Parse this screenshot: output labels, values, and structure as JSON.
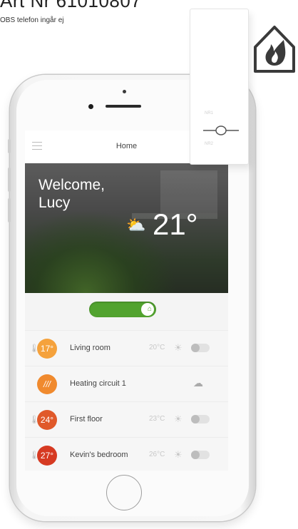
{
  "header": {
    "title": "Art Nr 61010807",
    "note": "OBS telefon ingår ej"
  },
  "app": {
    "nav_title": "Home",
    "welcome_line1": "Welcome,",
    "welcome_line2": "Lucy",
    "outside_temp": "21°",
    "weather_icon": "partly-cloudy-icon",
    "mode_toggle": {
      "state": "on",
      "icon": "house-icon",
      "color": "#52a32f"
    }
  },
  "rows": [
    {
      "badge": "17°",
      "label": "Living room",
      "setpoint": "20°C",
      "badge_color": "#f5a23c"
    },
    {
      "badge": "///",
      "label": "Heating circuit 1",
      "setpoint": "",
      "badge_color": "#f08a2e"
    },
    {
      "badge": "24°",
      "label": "First floor",
      "setpoint": "23°C",
      "badge_color": "#e0592a"
    },
    {
      "badge": "27°",
      "label": "Kevin's bedroom",
      "setpoint": "26°C",
      "badge_color": "#d63a22"
    }
  ],
  "device": {
    "symbol": "⊸⊶",
    "mark_top": "NR1",
    "mark_bottom": "NR2"
  },
  "logo": {
    "icon": "house-flame-icon",
    "color": "#3a3a3a"
  }
}
